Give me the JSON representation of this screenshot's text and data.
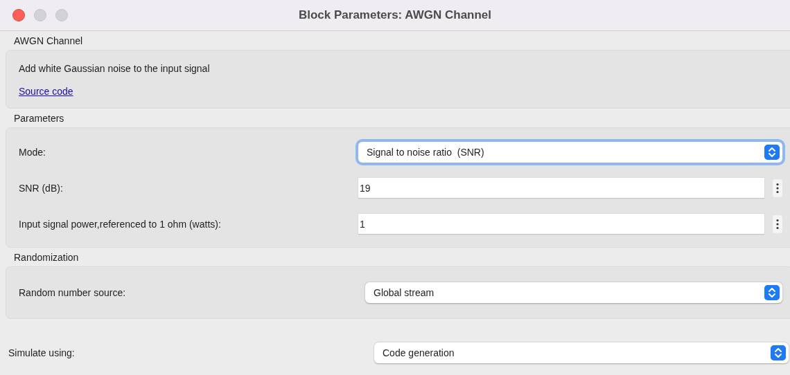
{
  "window": {
    "title": "Block Parameters: AWGN Channel",
    "controls": [
      {
        "kind": "close",
        "disabled": false
      },
      {
        "kind": "minimize",
        "disabled": true
      },
      {
        "kind": "zoom",
        "disabled": true
      }
    ]
  },
  "sections": [
    {
      "title": "AWGN Channel",
      "description": "Add white Gaussian noise to the input signal",
      "link": "Source code"
    },
    {
      "title": "Parameters",
      "rows": [
        {
          "label": "Mode:",
          "kind": "select",
          "value": "Signal to noise ratio  (SNR)",
          "focused": true
        },
        {
          "label": "SNR (dB):",
          "kind": "text",
          "value": "19",
          "focused": false
        },
        {
          "label": "Input signal power,referenced to 1 ohm (watts):",
          "kind": "text",
          "value": "1",
          "focused": false
        }
      ]
    },
    {
      "title": "Randomization",
      "rows": [
        {
          "label": "Random number source:",
          "kind": "select",
          "value": "Global stream",
          "focused": false
        }
      ]
    }
  ],
  "simulate": {
    "label": "Simulate using:",
    "kind": "select",
    "value": "Code generation",
    "focused": false
  }
}
